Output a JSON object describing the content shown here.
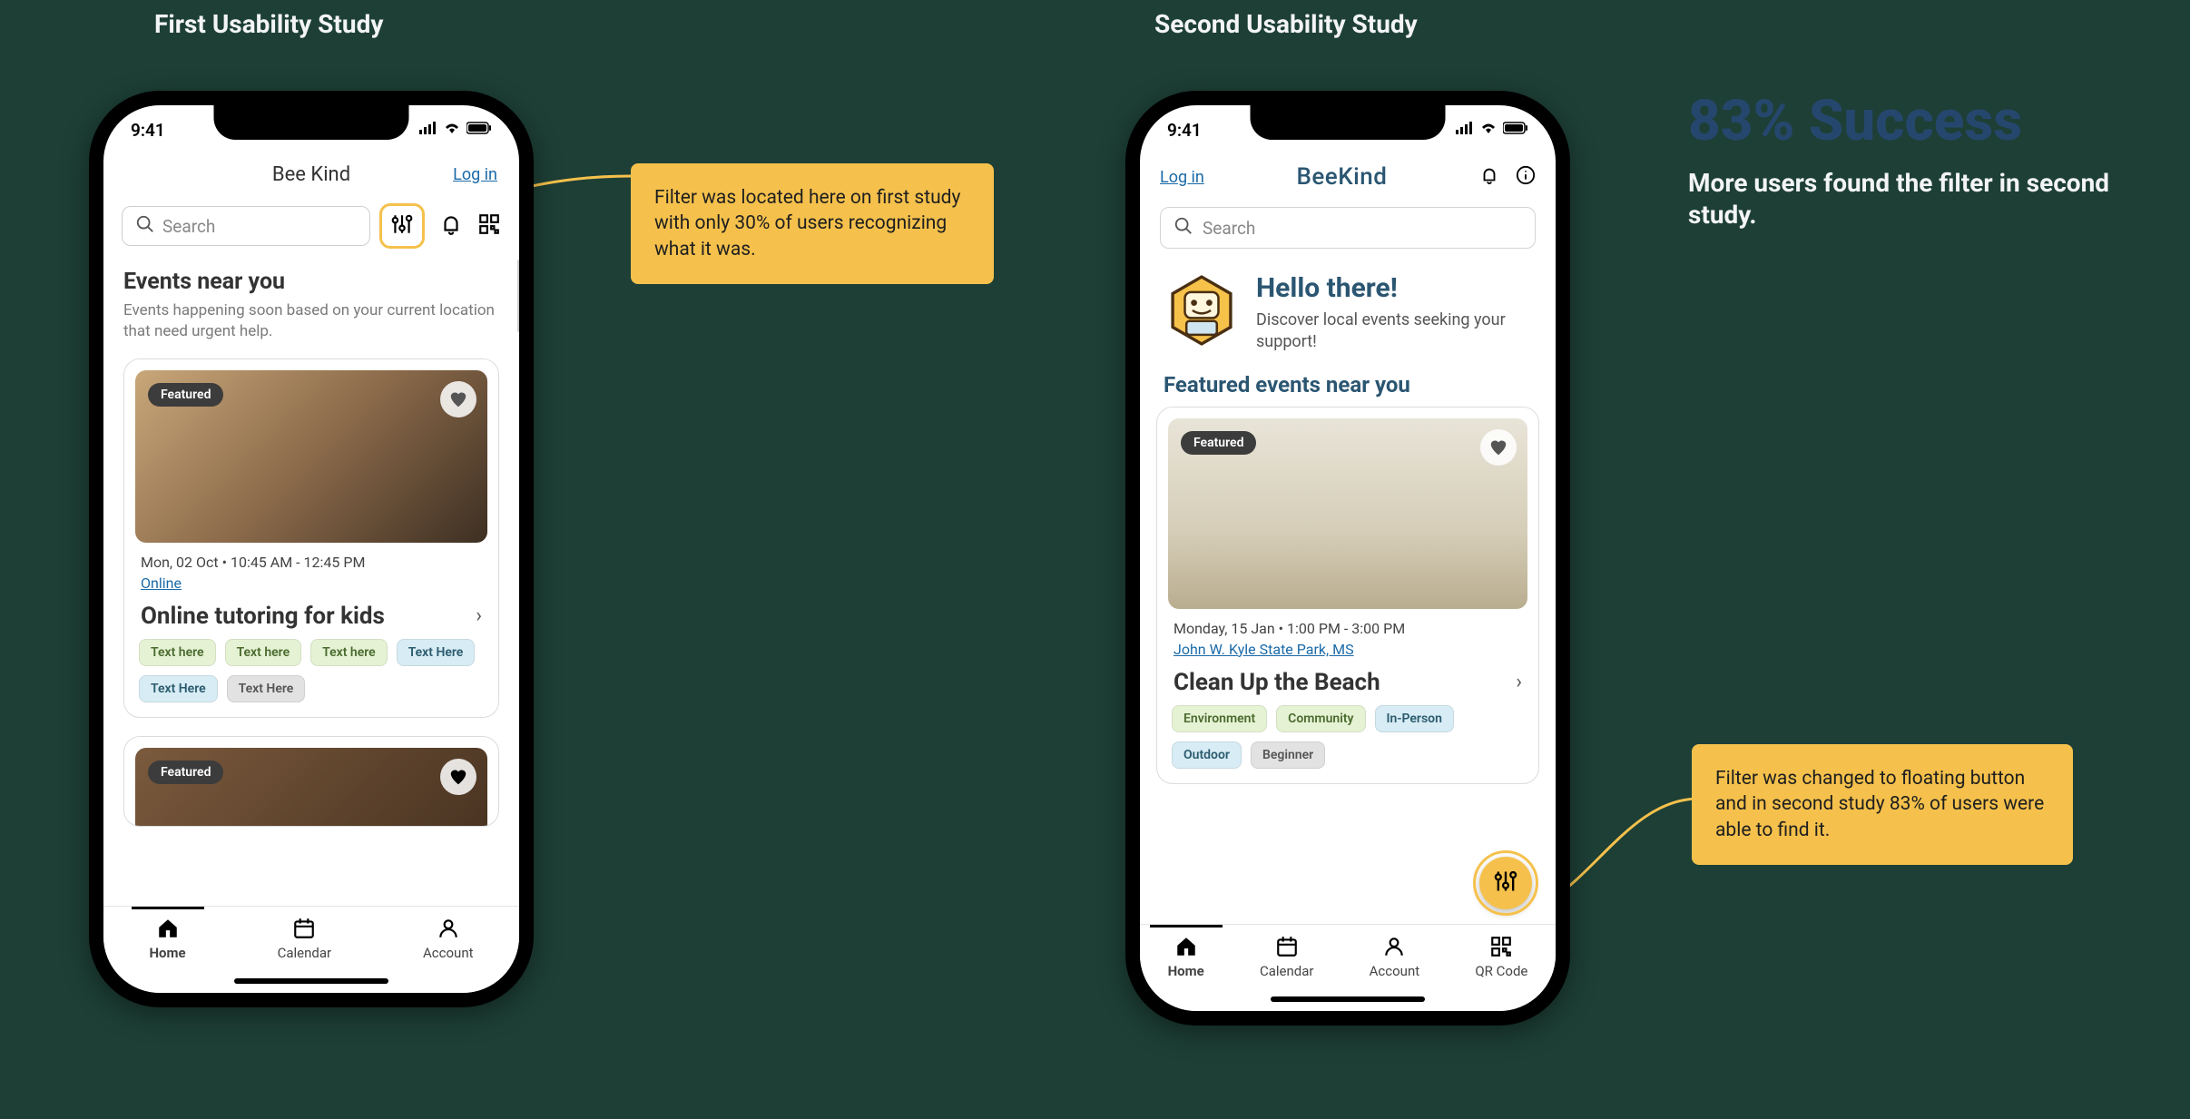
{
  "titles": {
    "first": "First Usability Study",
    "second": "Second Usability Study"
  },
  "success": {
    "headline": "83% Success",
    "sub": "More users found the filter in second study."
  },
  "callouts": {
    "first": "Filter was located here on first study with only 30% of users recognizing what it was.",
    "second": "Filter was changed to floating button and in second study 83% of users were able to find it."
  },
  "status": {
    "time": "9:41"
  },
  "screen1": {
    "brand": "Bee Kind",
    "login": "Log in",
    "search_placeholder": "Search",
    "heading": "Events near you",
    "subheading": "Events happening soon based on your current location that need urgent help.",
    "card1": {
      "featured": "Featured",
      "meta": "Mon, 02 Oct  •  10:45 AM - 12:45 PM",
      "location": "Online",
      "title": "Online tutoring for kids",
      "tags_row1": [
        "Text here",
        "Text here",
        "Text here"
      ],
      "tags_row2": [
        "Text Here",
        "Text Here",
        "Text Here"
      ]
    },
    "card2": {
      "featured": "Featured"
    },
    "nav": {
      "home": "Home",
      "calendar": "Calendar",
      "account": "Account"
    }
  },
  "screen2": {
    "login": "Log in",
    "brand": "BeeKind",
    "search_placeholder": "Search",
    "hello_title": "Hello there!",
    "hello_sub": "Discover local events seeking your support!",
    "section": "Featured events near you",
    "card": {
      "featured": "Featured",
      "meta": "Monday, 15 Jan  •  1:00 PM - 3:00 PM",
      "location": "John W. Kyle State Park, MS",
      "title": "Clean Up the Beach",
      "tags_row1": [
        "Environment",
        "Community",
        "In-Person"
      ],
      "tags_row2": [
        "Outdoor",
        "Beginner"
      ]
    },
    "nav": {
      "home": "Home",
      "calendar": "Calendar",
      "account": "Account",
      "qr": "QR Code"
    }
  }
}
